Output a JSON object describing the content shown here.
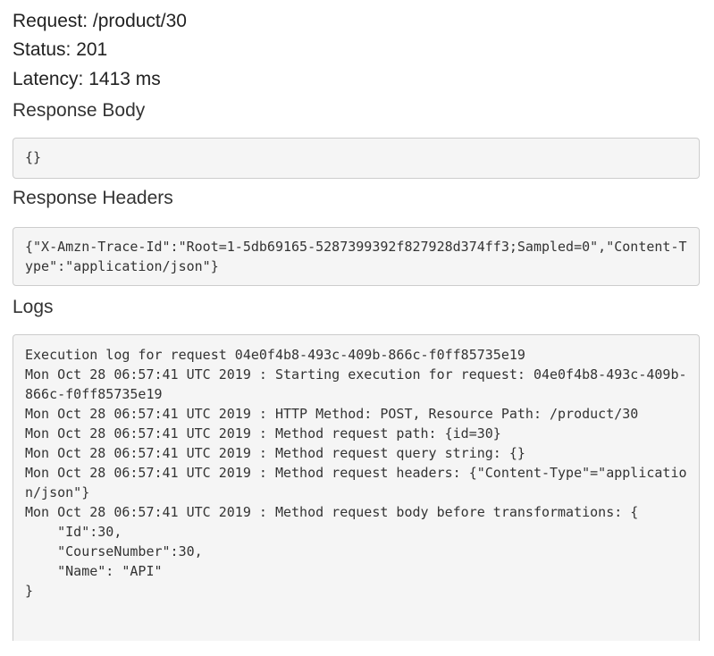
{
  "summary": {
    "request_label": "Request: /product/30",
    "status_label": "Status: 201",
    "latency_label": "Latency: 1413 ms"
  },
  "sections": {
    "response_body_title": "Response Body",
    "response_body": "{}",
    "response_headers_title": "Response Headers",
    "response_headers": "{\"X-Amzn-Trace-Id\":\"Root=1-5db69165-5287399392f827928d374ff3;Sampled=0\",\"Content-Type\":\"application/json\"}",
    "logs_title": "Logs",
    "logs": "Execution log for request 04e0f4b8-493c-409b-866c-f0ff85735e19\nMon Oct 28 06:57:41 UTC 2019 : Starting execution for request: 04e0f4b8-493c-409b-866c-f0ff85735e19\nMon Oct 28 06:57:41 UTC 2019 : HTTP Method: POST, Resource Path: /product/30\nMon Oct 28 06:57:41 UTC 2019 : Method request path: {id=30}\nMon Oct 28 06:57:41 UTC 2019 : Method request query string: {}\nMon Oct 28 06:57:41 UTC 2019 : Method request headers: {\"Content-Type\"=\"application/json\"}\nMon Oct 28 06:57:41 UTC 2019 : Method request body before transformations: {\n    \"Id\":30,\n    \"CourseNumber\":30,\n    \"Name\": \"API\"\n}"
  }
}
